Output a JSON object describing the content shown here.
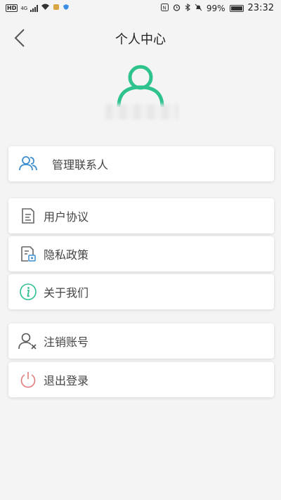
{
  "status_bar": {
    "hd": "HD",
    "network": "4G",
    "battery_text": "99%",
    "time": "23:32"
  },
  "header": {
    "title": "个人中心"
  },
  "menu": {
    "contacts": "管理联系人",
    "agreement": "用户协议",
    "privacy": "隐私政策",
    "about": "关于我们",
    "cancel_account": "注销账号",
    "logout": "退出登录"
  },
  "colors": {
    "accent_green": "#2ec28c",
    "contacts_blue": "#3d8fd1",
    "logout_red": "#e27b7b"
  }
}
